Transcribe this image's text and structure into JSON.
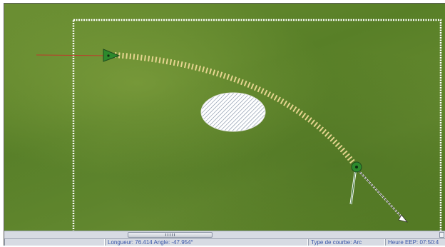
{
  "status": {
    "measure": "Longueur: 76.414 Angle: -47.954°",
    "curve_type": "Type de courbe: Arc",
    "clock": "Heure EEP: 07:50:4"
  },
  "colors": {
    "grass": "#5f8a2c",
    "track_ties": "#e6d590",
    "marker_green": "#2d8a2d",
    "selection_border": "#ffffff",
    "status_text": "#3856a8"
  }
}
